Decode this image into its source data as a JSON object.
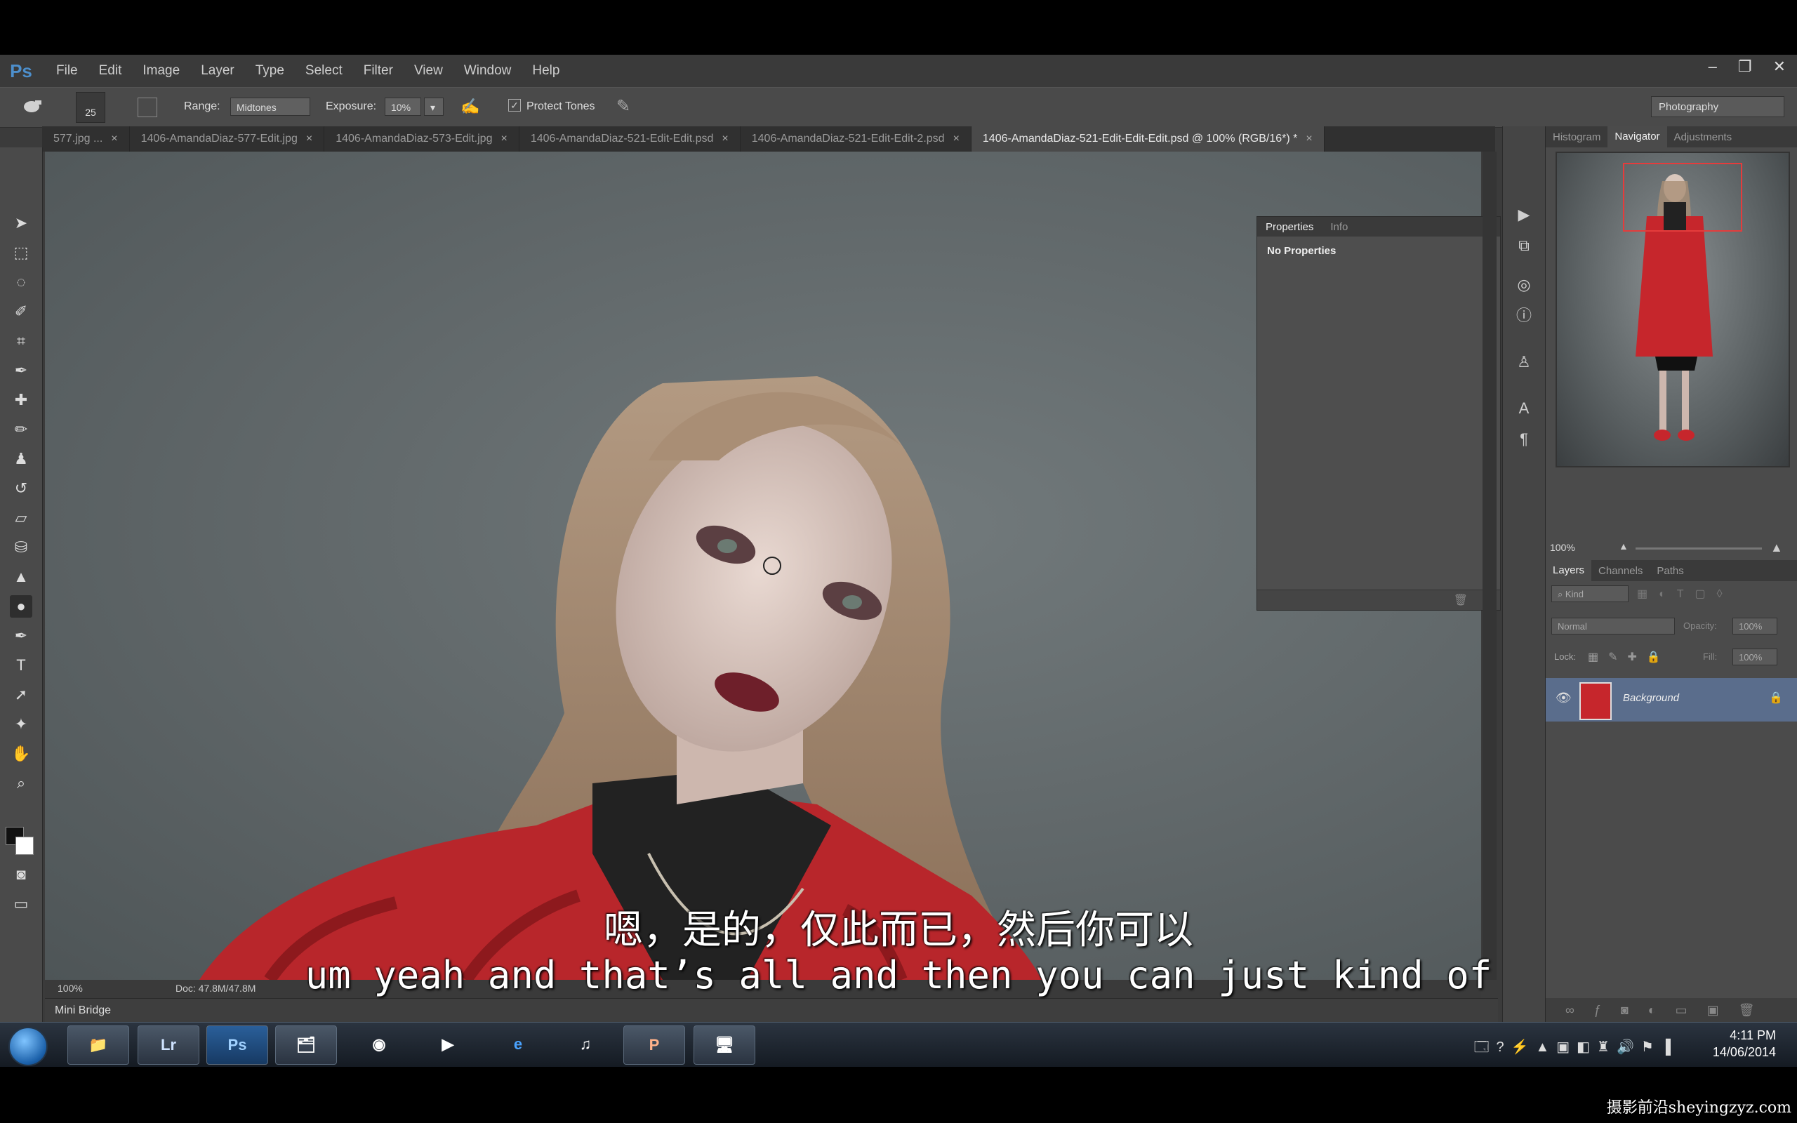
{
  "app": {
    "logo": "Ps",
    "menu": [
      "File",
      "Edit",
      "Image",
      "Layer",
      "Type",
      "Select",
      "Filter",
      "View",
      "Window",
      "Help"
    ],
    "window_controls": [
      "–",
      "❐",
      "✕"
    ]
  },
  "options": {
    "brush_size": "25",
    "range_label": "Range:",
    "range_value": "Midtones",
    "exposure_label": "Exposure:",
    "exposure_value": "10%",
    "protect_tones_label": "Protect Tones",
    "protect_tones_checked": true,
    "workspace": "Photography"
  },
  "tabs": [
    {
      "label": "577.jpg ...",
      "active": false
    },
    {
      "label": "1406-AmandaDiaz-577-Edit.jpg",
      "active": false
    },
    {
      "label": "1406-AmandaDiaz-573-Edit.jpg",
      "active": false
    },
    {
      "label": "1406-AmandaDiaz-521-Edit-Edit.psd",
      "active": false
    },
    {
      "label": "1406-AmandaDiaz-521-Edit-Edit-2.psd",
      "active": false
    },
    {
      "label": "1406-AmandaDiaz-521-Edit-Edit-Edit.psd @ 100% (RGB/16*) *",
      "active": true
    }
  ],
  "status": {
    "zoom": "100%",
    "doc": "Doc: 47.8M/47.8M"
  },
  "mini_bridge": "Mini Bridge",
  "properties_panel": {
    "tabs": [
      "Properties",
      "Info"
    ],
    "content": "No Properties"
  },
  "navigator_panel": {
    "tabs": [
      "Histogram",
      "Navigator",
      "Adjustments"
    ],
    "zoom": "100%"
  },
  "layers_panel": {
    "tabs": [
      "Layers",
      "Channels",
      "Paths"
    ],
    "filter": "Kind",
    "blend_mode": "Normal",
    "opacity_label": "Opacity:",
    "opacity_value": "100%",
    "lock_label": "Lock:",
    "fill_label": "Fill:",
    "fill_value": "100%",
    "layers": [
      {
        "name": "Background",
        "locked": true,
        "visible": true
      }
    ]
  },
  "taskbar": {
    "apps": [
      "Lr",
      "Ps"
    ],
    "time": "4:11 PM",
    "date": "14/06/2014"
  },
  "subtitles": {
    "chinese": "嗯，是的，仅此而已，然后你可以",
    "english": "um yeah and that’s all and then you can just kind of"
  },
  "watermark": "摄影前沿sheyingzyz.com"
}
